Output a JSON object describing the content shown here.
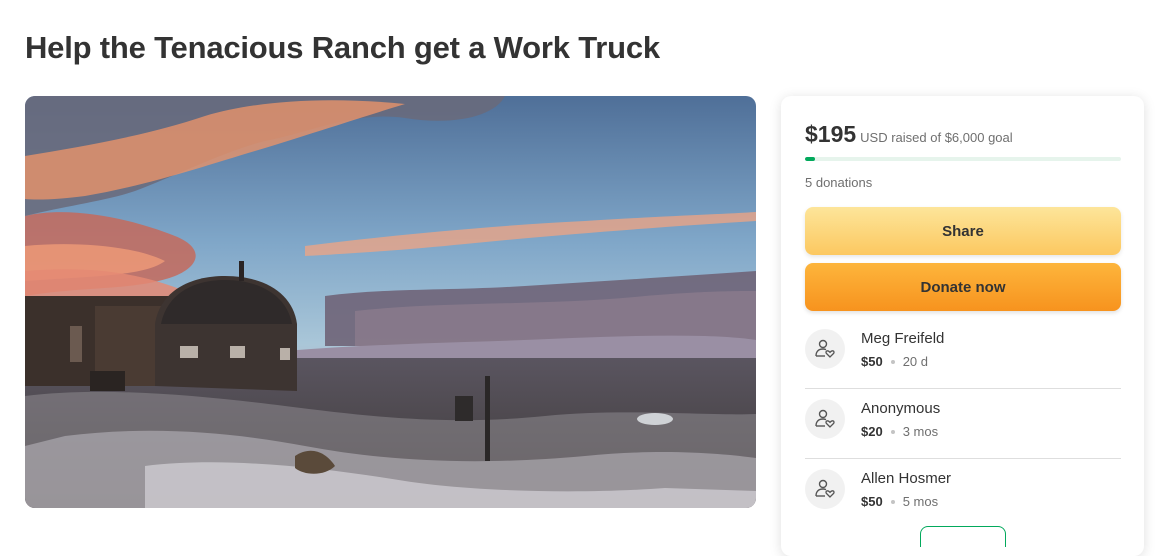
{
  "page": {
    "title": "Help the Tenacious Ranch get a Work Truck"
  },
  "fundraiser": {
    "raised_amount": "$195",
    "raised_text": "USD raised of $6,000 goal",
    "progress_fraction": 0.0325,
    "donation_count": "5 donations",
    "share_label": "Share",
    "donate_label": "Donate now"
  },
  "donors": [
    {
      "name": "Meg Freifeld",
      "amount": "$50",
      "time": "20 d"
    },
    {
      "name": "Anonymous",
      "amount": "$20",
      "time": "3 mos"
    },
    {
      "name": "Allen Hosmer",
      "amount": "$50",
      "time": "5 mos"
    }
  ],
  "icons": {
    "donor_avatar": "donor-heart-icon"
  },
  "colors": {
    "progress": "#02a95c",
    "share": "#fdd57c",
    "donate": "#f9a42c"
  }
}
